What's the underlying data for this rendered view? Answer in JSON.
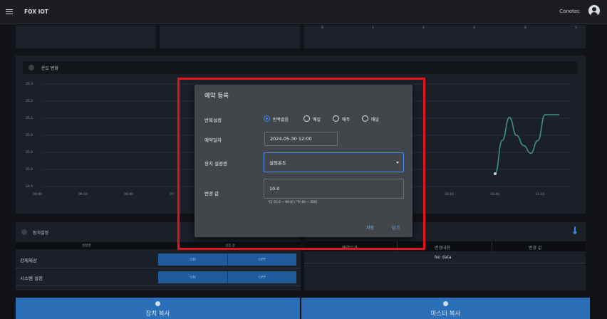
{
  "app": {
    "title": "FOX IOT",
    "user_name": "Conotec",
    "menu_icon": "hamburger-icon",
    "avatar_icon": "user-avatar-icon"
  },
  "top_axis_labels": [
    "0",
    "1",
    "2",
    "3",
    "4",
    "5"
  ],
  "temperature_chart": {
    "title": "온도 변화",
    "chart_data": {
      "type": "line",
      "x": [
        "09:40",
        "10:10",
        "10:40",
        "11:10"
      ],
      "x_ticks": [
        "09:40",
        "06:10",
        "06:40",
        "07:",
        "10:10",
        "10:40",
        "11:10"
      ],
      "y_ticks": [
        "25.3",
        "25.2",
        "25.1",
        "25.0",
        "25.0",
        "25.0",
        "24.9"
      ],
      "series": [
        {
          "color": "#3f8f82",
          "points": [
            {
              "t": "10:40",
              "v": 24.95
            },
            {
              "t": "10:45",
              "v": 25.08
            },
            {
              "t": "10:50",
              "v": 25.17
            },
            {
              "t": "10:55",
              "v": 25.1
            },
            {
              "t": "11:00",
              "v": 25.06
            },
            {
              "t": "11:05",
              "v": 25.03
            },
            {
              "t": "11:10",
              "v": 25.08
            },
            {
              "t": "11:15",
              "v": 25.18
            },
            {
              "t": "11:20",
              "v": 25.18
            },
            {
              "t": "11:25",
              "v": 25.18
            }
          ]
        }
      ],
      "grid": true
    }
  },
  "device_settings": {
    "title": "장치설정",
    "headers": [
      "설정명",
      "설정 값"
    ],
    "rows": [
      {
        "name": "강제제상",
        "on_label": "ON",
        "off_label": "OFF"
      },
      {
        "name": "시스템 설정",
        "on_label": "ON",
        "off_label": "OFF"
      }
    ]
  },
  "schedule_table": {
    "headers": [
      "예약일자",
      "변경내용",
      "변경 값"
    ],
    "empty_text": "No data",
    "icon": "thermometer-icon"
  },
  "bottom_buttons": {
    "device_copy": "장치 복사",
    "master_copy": "마스터 복사"
  },
  "modal": {
    "title": "예약 등록",
    "repeat_label": "반복설정",
    "repeat_options": [
      "반복없음",
      "매일",
      "매주",
      "매달"
    ],
    "repeat_selected": "반복없음",
    "date_label": "예약일자",
    "date_value": "2024-05-30 12:00",
    "setting_name_label": "장치 설정명",
    "setting_name_value": "설정온도",
    "change_value_label": "변경 값",
    "change_value": "10.0",
    "range_hint": "°C[-55.0 ~ 99.9] / °F[-60 ~ 200]",
    "save_label": "저장",
    "close_label": "닫기"
  },
  "highlight_color": "#e3141b"
}
